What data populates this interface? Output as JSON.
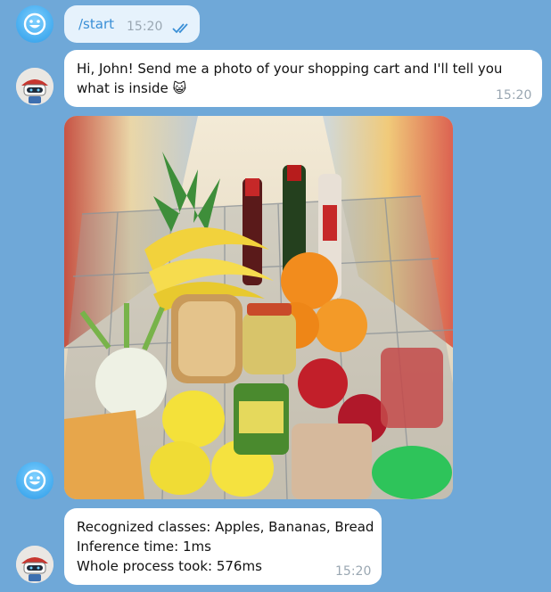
{
  "messages": [
    {
      "text": "/start",
      "time": "15:20",
      "status_icon": "double-check-icon"
    },
    {
      "text": "Hi, John! Send me a photo of your shopping cart and I'll tell you what is inside 😺",
      "time": "15:20"
    },
    {
      "image": "shopping-cart-photo"
    },
    {
      "lines": [
        "Recognized classes: Apples, Bananas, Bread",
        "Inference time: 1ms",
        "Whole process took: 576ms"
      ],
      "time": "15:20"
    }
  ],
  "colors": {
    "background": "#6fa8d8",
    "outgoing_bubble": "#e6f2fc",
    "incoming_bubble": "#ffffff",
    "link_text": "#3a8fd6",
    "timestamp": "#9aa7b2"
  }
}
